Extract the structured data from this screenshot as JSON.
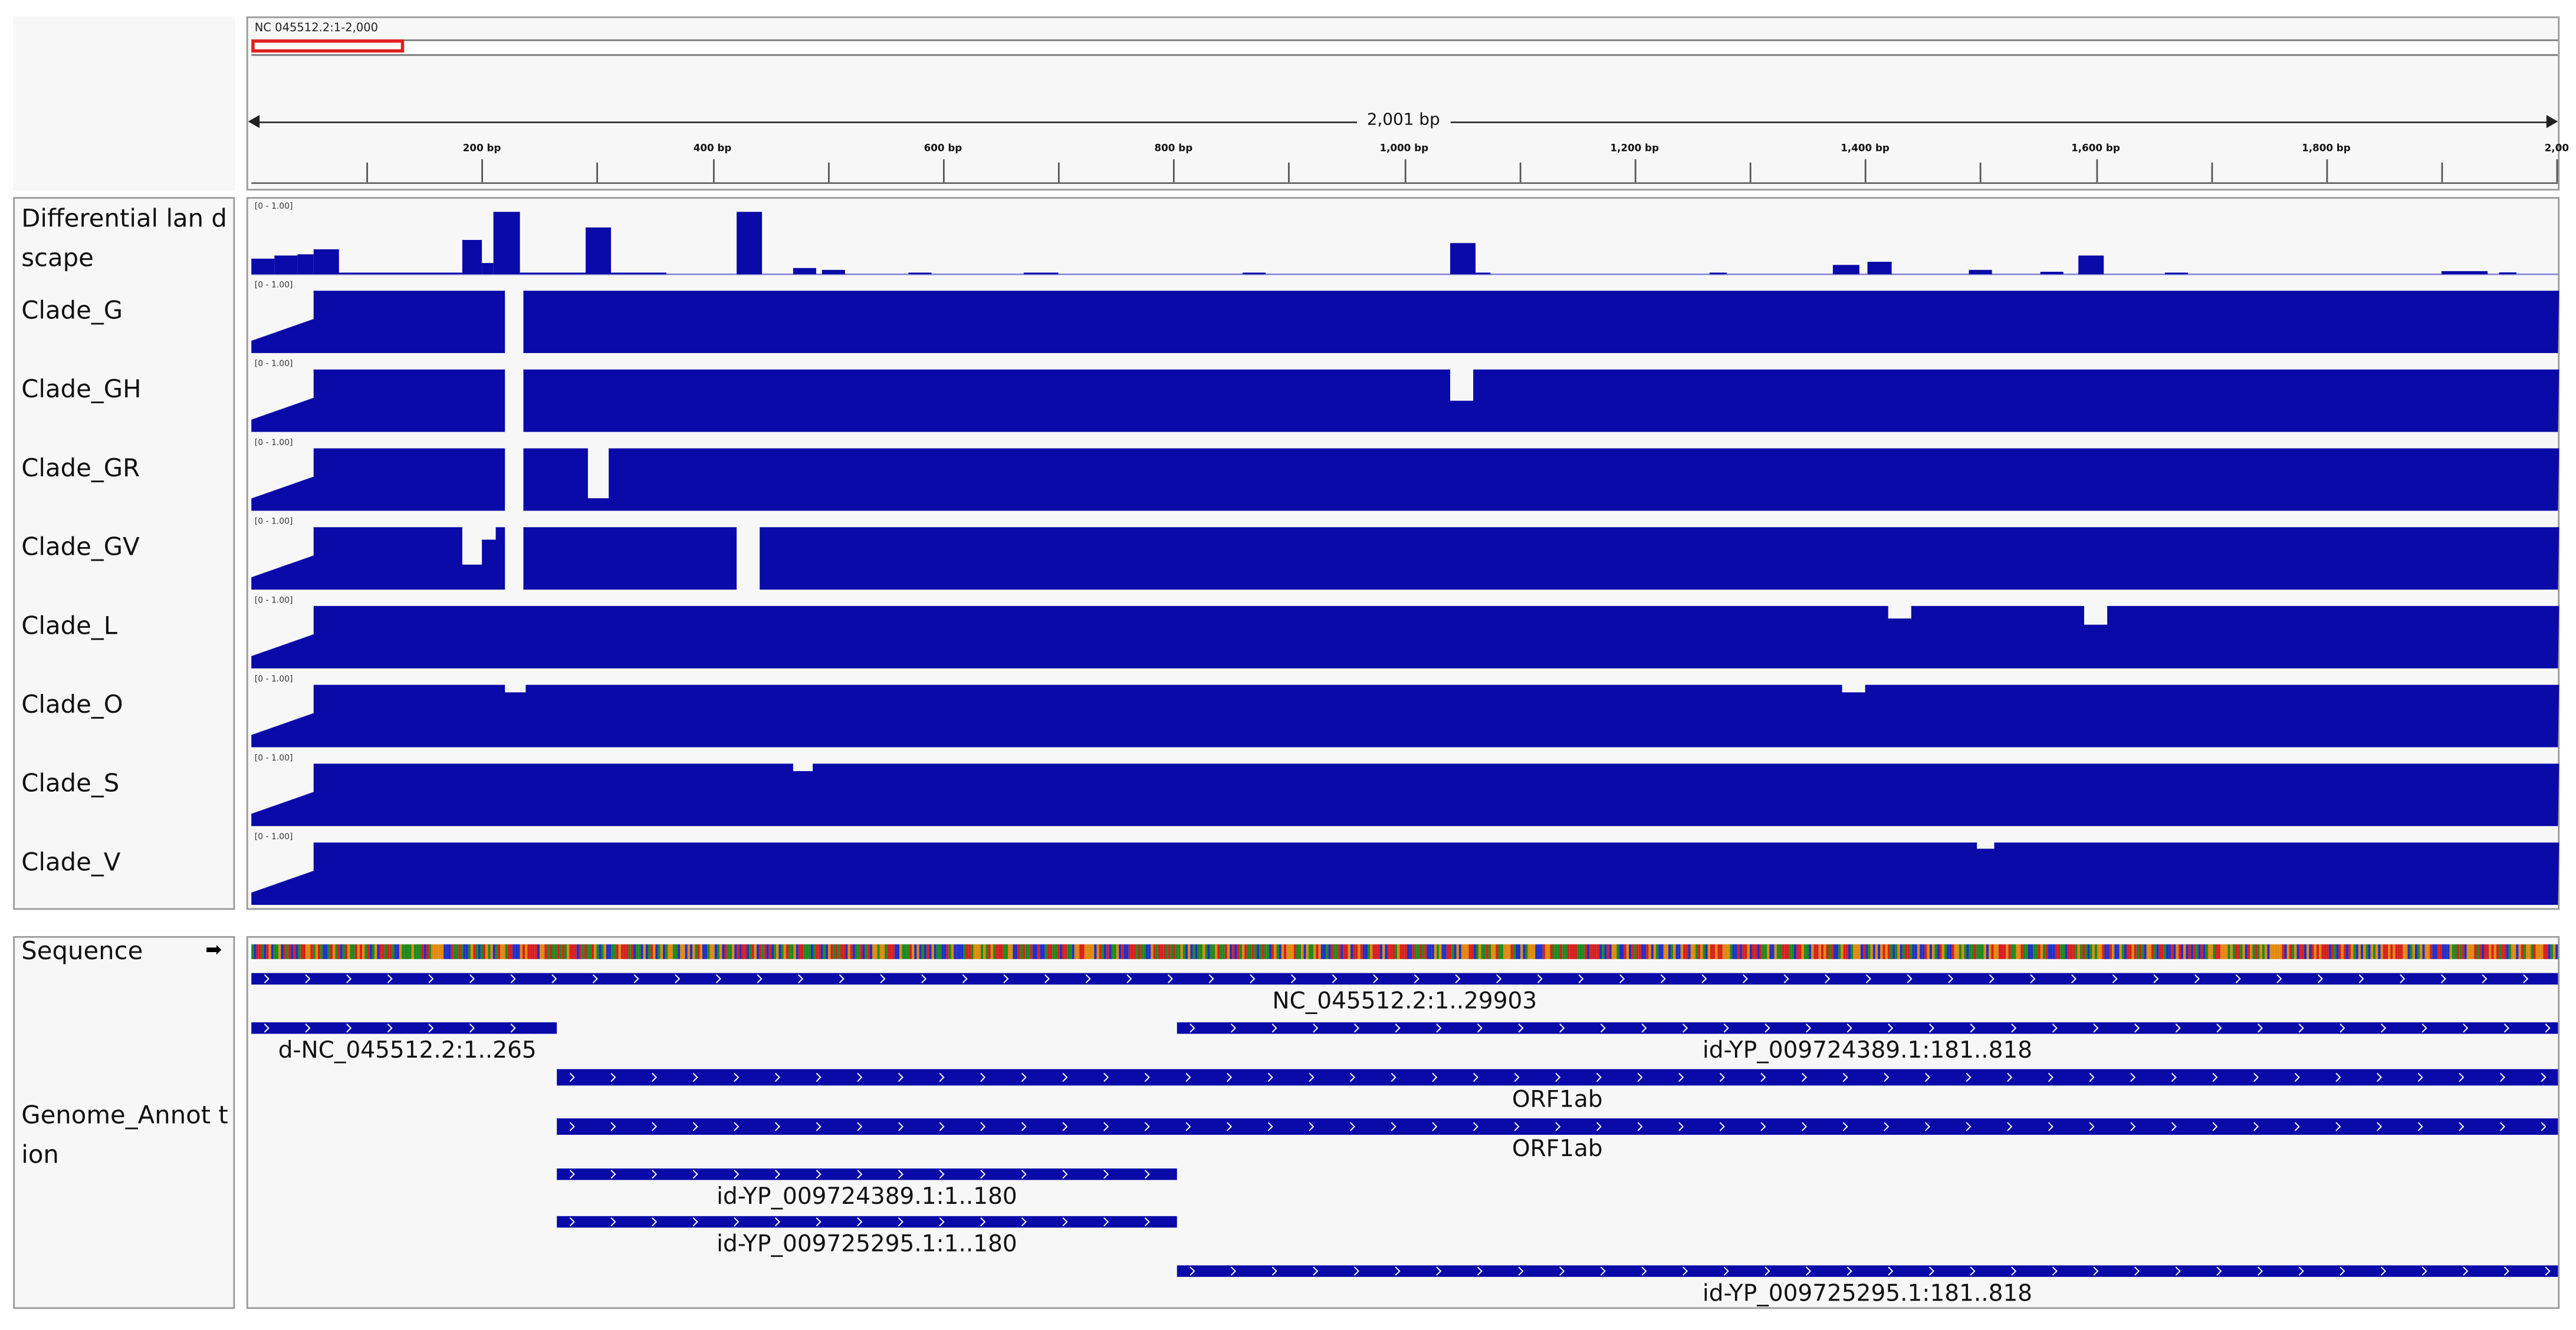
{
  "ruler": {
    "locus": "NC 045512.2:1-2,000",
    "span_label": "2,001 bp",
    "tick_labels": [
      {
        "bp": 200,
        "label": "200 bp"
      },
      {
        "bp": 400,
        "label": "400 bp"
      },
      {
        "bp": 600,
        "label": "600 bp"
      },
      {
        "bp": 800,
        "label": "800 bp"
      },
      {
        "bp": 1000,
        "label": "1,000 bp"
      },
      {
        "bp": 1200,
        "label": "1,200 bp"
      },
      {
        "bp": 1400,
        "label": "1,400 bp"
      },
      {
        "bp": 1600,
        "label": "1,600 bp"
      },
      {
        "bp": 1800,
        "label": "1,800 bp"
      },
      {
        "bp": 2000,
        "label": "2,00"
      }
    ],
    "view_range_bp": [
      0,
      2001
    ]
  },
  "colors": {
    "bar": "#0a0aa8",
    "highlight": "#e02020"
  },
  "tracks": [
    {
      "name": "Differential lan dscape",
      "range": "[0 - 1.00]",
      "type": "bars",
      "bars": [
        [
          0,
          20,
          0.25
        ],
        [
          20,
          40,
          0.3
        ],
        [
          40,
          54,
          0.32
        ],
        [
          54,
          76,
          0.4
        ],
        [
          76,
          183,
          0.02
        ],
        [
          183,
          200,
          0.55
        ],
        [
          200,
          210,
          0.18
        ],
        [
          210,
          233,
          1.0
        ],
        [
          233,
          290,
          0.02
        ],
        [
          290,
          312,
          0.75
        ],
        [
          312,
          360,
          0.02
        ],
        [
          421,
          443,
          1.0
        ],
        [
          470,
          490,
          0.1
        ],
        [
          495,
          515,
          0.07
        ],
        [
          570,
          590,
          0.02
        ],
        [
          670,
          700,
          0.02
        ],
        [
          860,
          880,
          0.02
        ],
        [
          1040,
          1062,
          0.5
        ],
        [
          1062,
          1075,
          0.02
        ],
        [
          1265,
          1280,
          0.02
        ],
        [
          1372,
          1395,
          0.15
        ],
        [
          1402,
          1423,
          0.2
        ],
        [
          1490,
          1510,
          0.07
        ],
        [
          1552,
          1572,
          0.04
        ],
        [
          1585,
          1607,
          0.3
        ],
        [
          1660,
          1680,
          0.02
        ],
        [
          1900,
          1940,
          0.05
        ],
        [
          1950,
          1965,
          0.03
        ]
      ]
    },
    {
      "name": "Clade_G",
      "range": "[0 - 1.00]",
      "type": "coverage",
      "dips": [
        [
          220,
          236,
          0.0
        ]
      ]
    },
    {
      "name": "Clade_GH",
      "range": "[0 - 1.00]",
      "type": "coverage",
      "dips": [
        [
          220,
          236,
          0.0
        ],
        [
          1040,
          1060,
          0.5
        ]
      ]
    },
    {
      "name": "Clade_GR",
      "range": "[0 - 1.00]",
      "type": "coverage",
      "dips": [
        [
          220,
          236,
          0.0
        ],
        [
          292,
          310,
          0.2
        ]
      ]
    },
    {
      "name": "Clade_GV",
      "range": "[0 - 1.00]",
      "type": "coverage",
      "dips": [
        [
          183,
          200,
          0.4
        ],
        [
          200,
          212,
          0.8
        ],
        [
          220,
          236,
          0.0
        ],
        [
          421,
          441,
          0.0
        ]
      ]
    },
    {
      "name": "Clade_L",
      "range": "[0 - 1.00]",
      "type": "coverage",
      "dips": [
        [
          1420,
          1440,
          0.8
        ],
        [
          1590,
          1610,
          0.7
        ]
      ]
    },
    {
      "name": "Clade_O",
      "range": "[0 - 1.00]",
      "type": "coverage",
      "dips": [
        [
          220,
          238,
          0.88
        ],
        [
          1380,
          1400,
          0.88
        ]
      ]
    },
    {
      "name": "Clade_S",
      "range": "[0 - 1.00]",
      "type": "coverage",
      "dips": [
        [
          470,
          487,
          0.88
        ]
      ]
    },
    {
      "name": "Clade_V",
      "range": "[0 - 1.00]",
      "type": "coverage",
      "dips": [
        [
          1497,
          1512,
          0.9
        ]
      ]
    }
  ],
  "sequence": {
    "name": "Sequence",
    "strand_arrow": "➡"
  },
  "annotation": {
    "name": "Genome_Annot tion",
    "features": [
      {
        "row": 0,
        "start": 0,
        "end": 2001,
        "label": "NC_045512.2:1..29903"
      },
      {
        "row": 1,
        "start": 0,
        "end": 265,
        "label": "d-NC_045512.2:1..265"
      },
      {
        "row": 1,
        "start": 803,
        "end": 2001,
        "label": "id-YP_009724389.1:181..818"
      },
      {
        "row": 2,
        "start": 265,
        "end": 2001,
        "label": "ORF1ab"
      },
      {
        "row": 3,
        "start": 265,
        "end": 2001,
        "label": "ORF1ab"
      },
      {
        "row": 4,
        "start": 265,
        "end": 803,
        "label": "id-YP_009724389.1:1..180"
      },
      {
        "row": 5,
        "start": 265,
        "end": 803,
        "label": "id-YP_009725295.1:1..180"
      },
      {
        "row": 6,
        "start": 803,
        "end": 2001,
        "label": "id-YP_009725295.1:181..818"
      }
    ]
  }
}
